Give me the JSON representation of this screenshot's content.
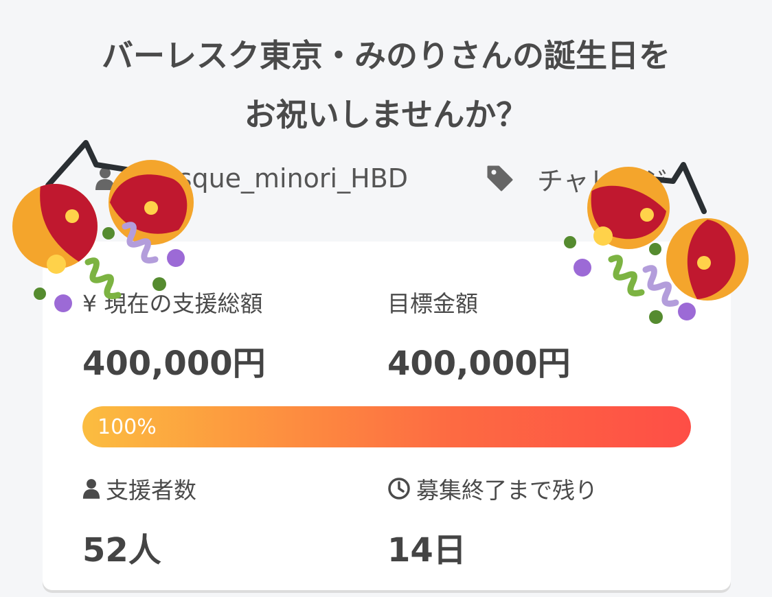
{
  "project": {
    "title_line1": "バーレスク東京・みのりさんの誕生日を",
    "title_line2": "お祝いしませんか？",
    "owner": "urlesque_minori_HBD",
    "category": "チャレンジ"
  },
  "stats": {
    "current_label": "¥ 現在の支援総額",
    "current_value": "400,000円",
    "goal_label": "目標金額",
    "goal_value": "400,000円",
    "progress_percent": 100,
    "progress_text": "100%",
    "supporters_label": "支援者数",
    "supporters_value": "52人",
    "remaining_label": "募集終了まで残り",
    "remaining_value": "14日"
  },
  "icons": {
    "user": "user-icon",
    "tag": "tag-icon",
    "clock": "clock-icon",
    "celebration": "party-popper-icon"
  },
  "colors": {
    "progress_start": "#fbbd40",
    "progress_end": "#fe4e46",
    "text": "#4a4a4a",
    "background": "#f5f6f8"
  }
}
